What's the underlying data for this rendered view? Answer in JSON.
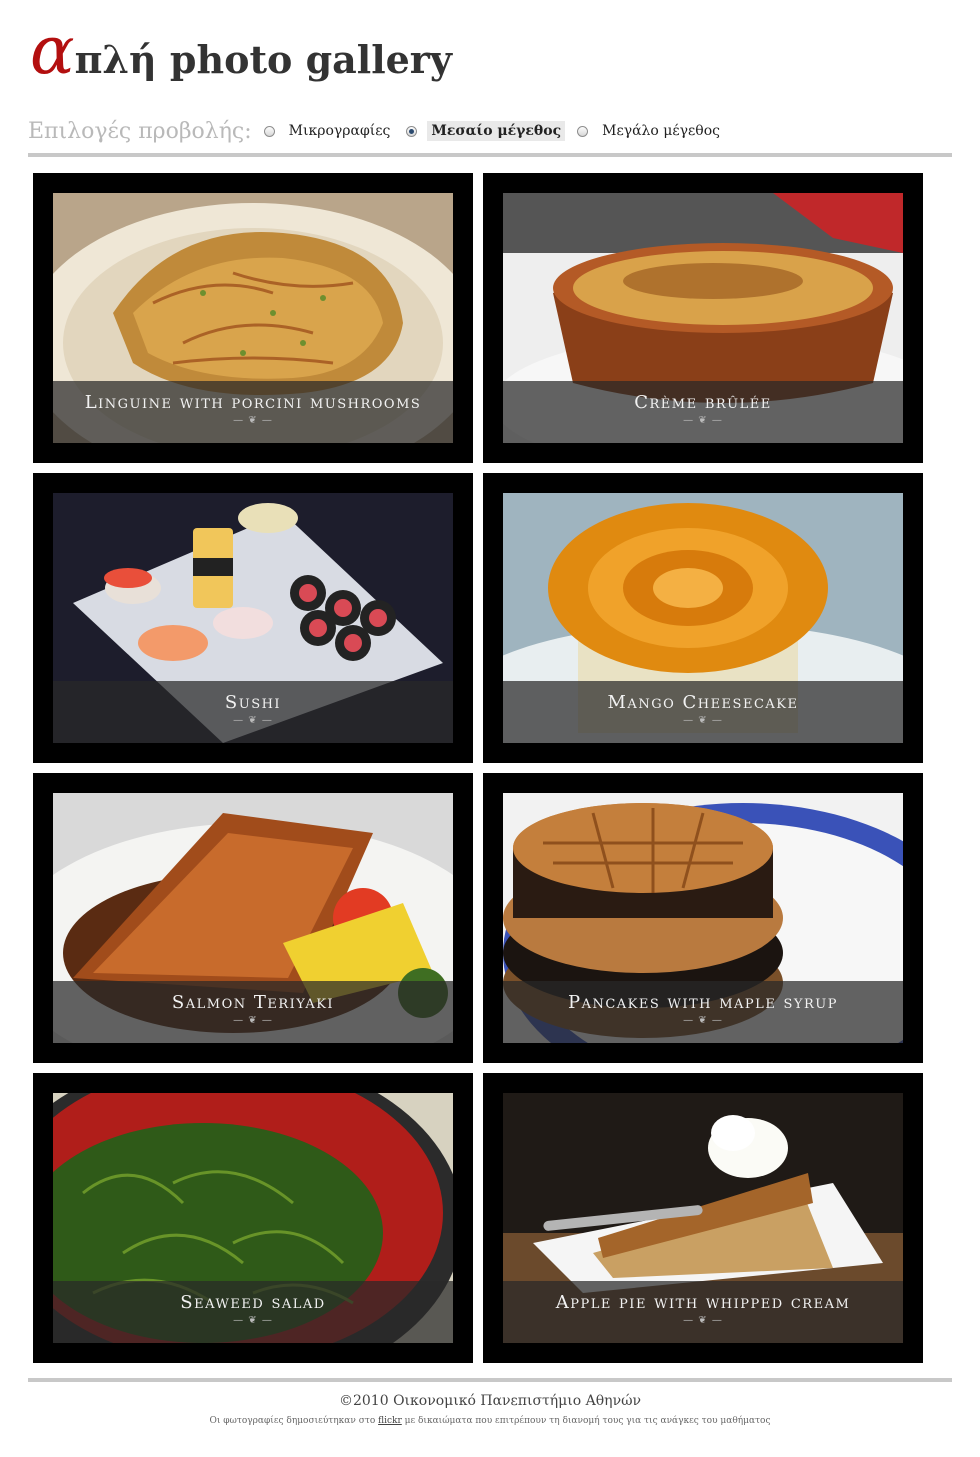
{
  "header": {
    "logo_alpha": "α",
    "logo_rest": "πλή photo gallery"
  },
  "view_options": {
    "title": "Επιλογές προβολής:",
    "options": [
      {
        "label": "Μικρογραφίες",
        "checked": false
      },
      {
        "label": "Μεσαίο μέγεθος",
        "checked": true
      },
      {
        "label": "Μεγάλο μέγεθος",
        "checked": false
      }
    ]
  },
  "gallery": {
    "items": [
      {
        "caption": "Linguine with porcini mushrooms",
        "ornament": "— ❦ —"
      },
      {
        "caption": "Crème brûlée",
        "ornament": "— ❦ —"
      },
      {
        "caption": "Sushi",
        "ornament": "— ❦ —"
      },
      {
        "caption": "Mango Cheesecake",
        "ornament": "— ❦ —"
      },
      {
        "caption": "Salmon Teriyaki",
        "ornament": "— ❦ —"
      },
      {
        "caption": "Pancakes with maple syrup",
        "ornament": "— ❦ —"
      },
      {
        "caption": "Seaweed salad",
        "ornament": "— ❦ —"
      },
      {
        "caption": "Apple pie with whipped cream",
        "ornament": "— ❦ —"
      }
    ]
  },
  "footer": {
    "copyright": "©2010 Οικονομικό Πανεπιστήμιο Αθηνών",
    "credits_before": "Οι φωτογραφίες δημοσιεύτηκαν στο ",
    "credits_link": "flickr",
    "credits_after": " με δικαιώματα που επιτρέπουν τη διανομή τους για τις ανάγκες του μαθήματος"
  },
  "colors": {
    "logo_alpha": "#b30f0f",
    "card_bg": "#000000",
    "rule": "#c8c8c8"
  }
}
